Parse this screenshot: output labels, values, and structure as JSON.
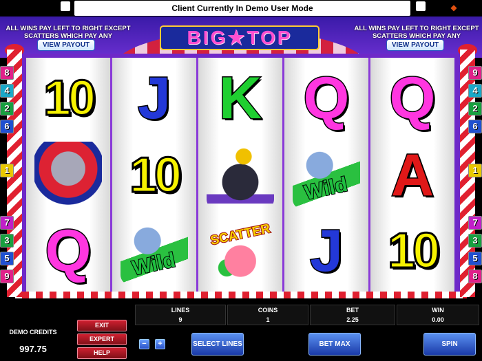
{
  "window": {
    "status_message": "Client Currently In Demo User Mode",
    "close_icon": "square-button-icon",
    "minimize_icon": "square-button-icon",
    "sound_icon": "speaker-icon",
    "sound_glyph": "◆"
  },
  "header": {
    "logo": "BIG★TOP",
    "rules_left": "ALL WINS PAY LEFT TO RIGHT EXCEPT SCATTERS WHICH PAY ANY",
    "rules_right": "ALL WINS PAY LEFT TO RIGHT EXCEPT SCATTERS WHICH PAY ANY",
    "view_payout_left": "VIEW PAYOUT",
    "view_payout_right": "VIEW PAYOUT"
  },
  "paylines": {
    "left": [
      {
        "label": "8",
        "color": "#e0218a"
      },
      {
        "label": "4",
        "color": "#1aa8c8"
      },
      {
        "label": "2",
        "color": "#18a040"
      },
      {
        "label": "6",
        "color": "#2050d0"
      },
      {
        "label": "1",
        "color": "#e8c800"
      },
      {
        "label": "7",
        "color": "#c020c8"
      },
      {
        "label": "3",
        "color": "#18a040"
      },
      {
        "label": "5",
        "color": "#2050d0"
      },
      {
        "label": "9",
        "color": "#e0218a"
      }
    ],
    "right": [
      {
        "label": "9",
        "color": "#e0218a"
      },
      {
        "label": "4",
        "color": "#1aa8c8"
      },
      {
        "label": "2",
        "color": "#18a040"
      },
      {
        "label": "6",
        "color": "#2050d0"
      },
      {
        "label": "1",
        "color": "#e8c800"
      },
      {
        "label": "7",
        "color": "#c020c8"
      },
      {
        "label": "3",
        "color": "#18a040"
      },
      {
        "label": "5",
        "color": "#2050d0"
      },
      {
        "label": "8",
        "color": "#e0218a"
      }
    ]
  },
  "reels": {
    "r1": {
      "s1": "10",
      "s2": "elephant",
      "s3": "Q"
    },
    "r2": {
      "s1": "J",
      "s2": "10",
      "s3": "Wild"
    },
    "r3": {
      "s1": "K",
      "s2": "seal",
      "s3": "SCATTER"
    },
    "r4": {
      "s1": "Q",
      "s2": "Wild",
      "s3": "J"
    },
    "r5": {
      "s1": "Q",
      "s2": "A",
      "s3": "10"
    }
  },
  "symbol_colors": {
    "Q": "#ff36e0",
    "J": "#2338d8",
    "K": "#1fcf30",
    "A": "#e01818",
    "10": "#f6f200"
  },
  "controls": {
    "credits_label": "DEMO CREDITS",
    "credits_value": "997.75",
    "exit": "EXIT",
    "expert": "EXPERT",
    "help": "HELP",
    "minus": "−",
    "plus": "+",
    "select_lines": "SELECT LINES",
    "bet_max": "BET MAX",
    "spin": "SPIN"
  },
  "stats": {
    "lines_label": "LINES",
    "lines_value": "9",
    "coins_label": "COINS",
    "coins_value": "1",
    "bet_label": "BET",
    "bet_value": "2.25",
    "win_label": "WIN",
    "win_value": "0.00"
  }
}
